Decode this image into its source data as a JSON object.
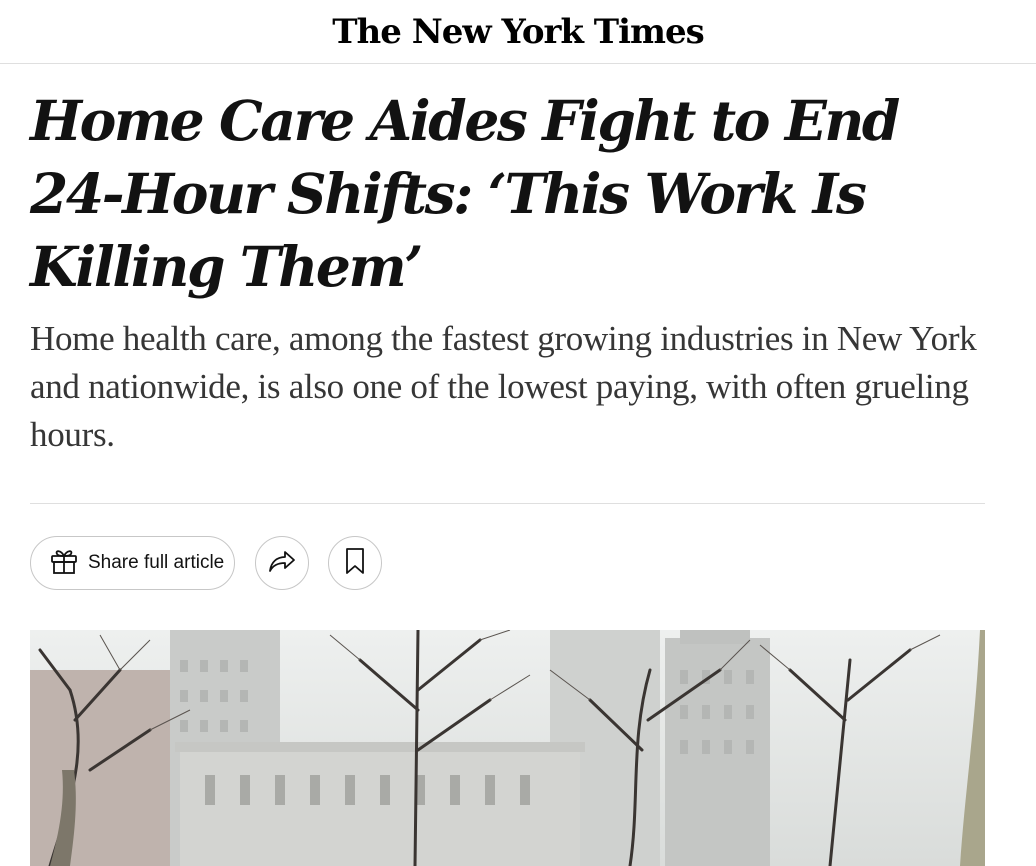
{
  "masthead": {
    "logo_text": "The New York Times"
  },
  "article": {
    "headline": "Home Care Aides Fight to End 24-Hour Shifts: ‘This Work Is Killing Them’",
    "summary": "Home health care, among the fastest growing industries in New York and nationwide, is also one of the lowest paying, with often grueling hours."
  },
  "toolbar": {
    "share_full_article_label": "Share full article",
    "gift_icon": "gift-icon",
    "share_icon": "share-arrow-icon",
    "save_icon": "bookmark-icon"
  },
  "colors": {
    "text": "#121212",
    "summary_text": "#363636",
    "divider": "#dfdfdf",
    "button_border": "#c7c7c7"
  }
}
